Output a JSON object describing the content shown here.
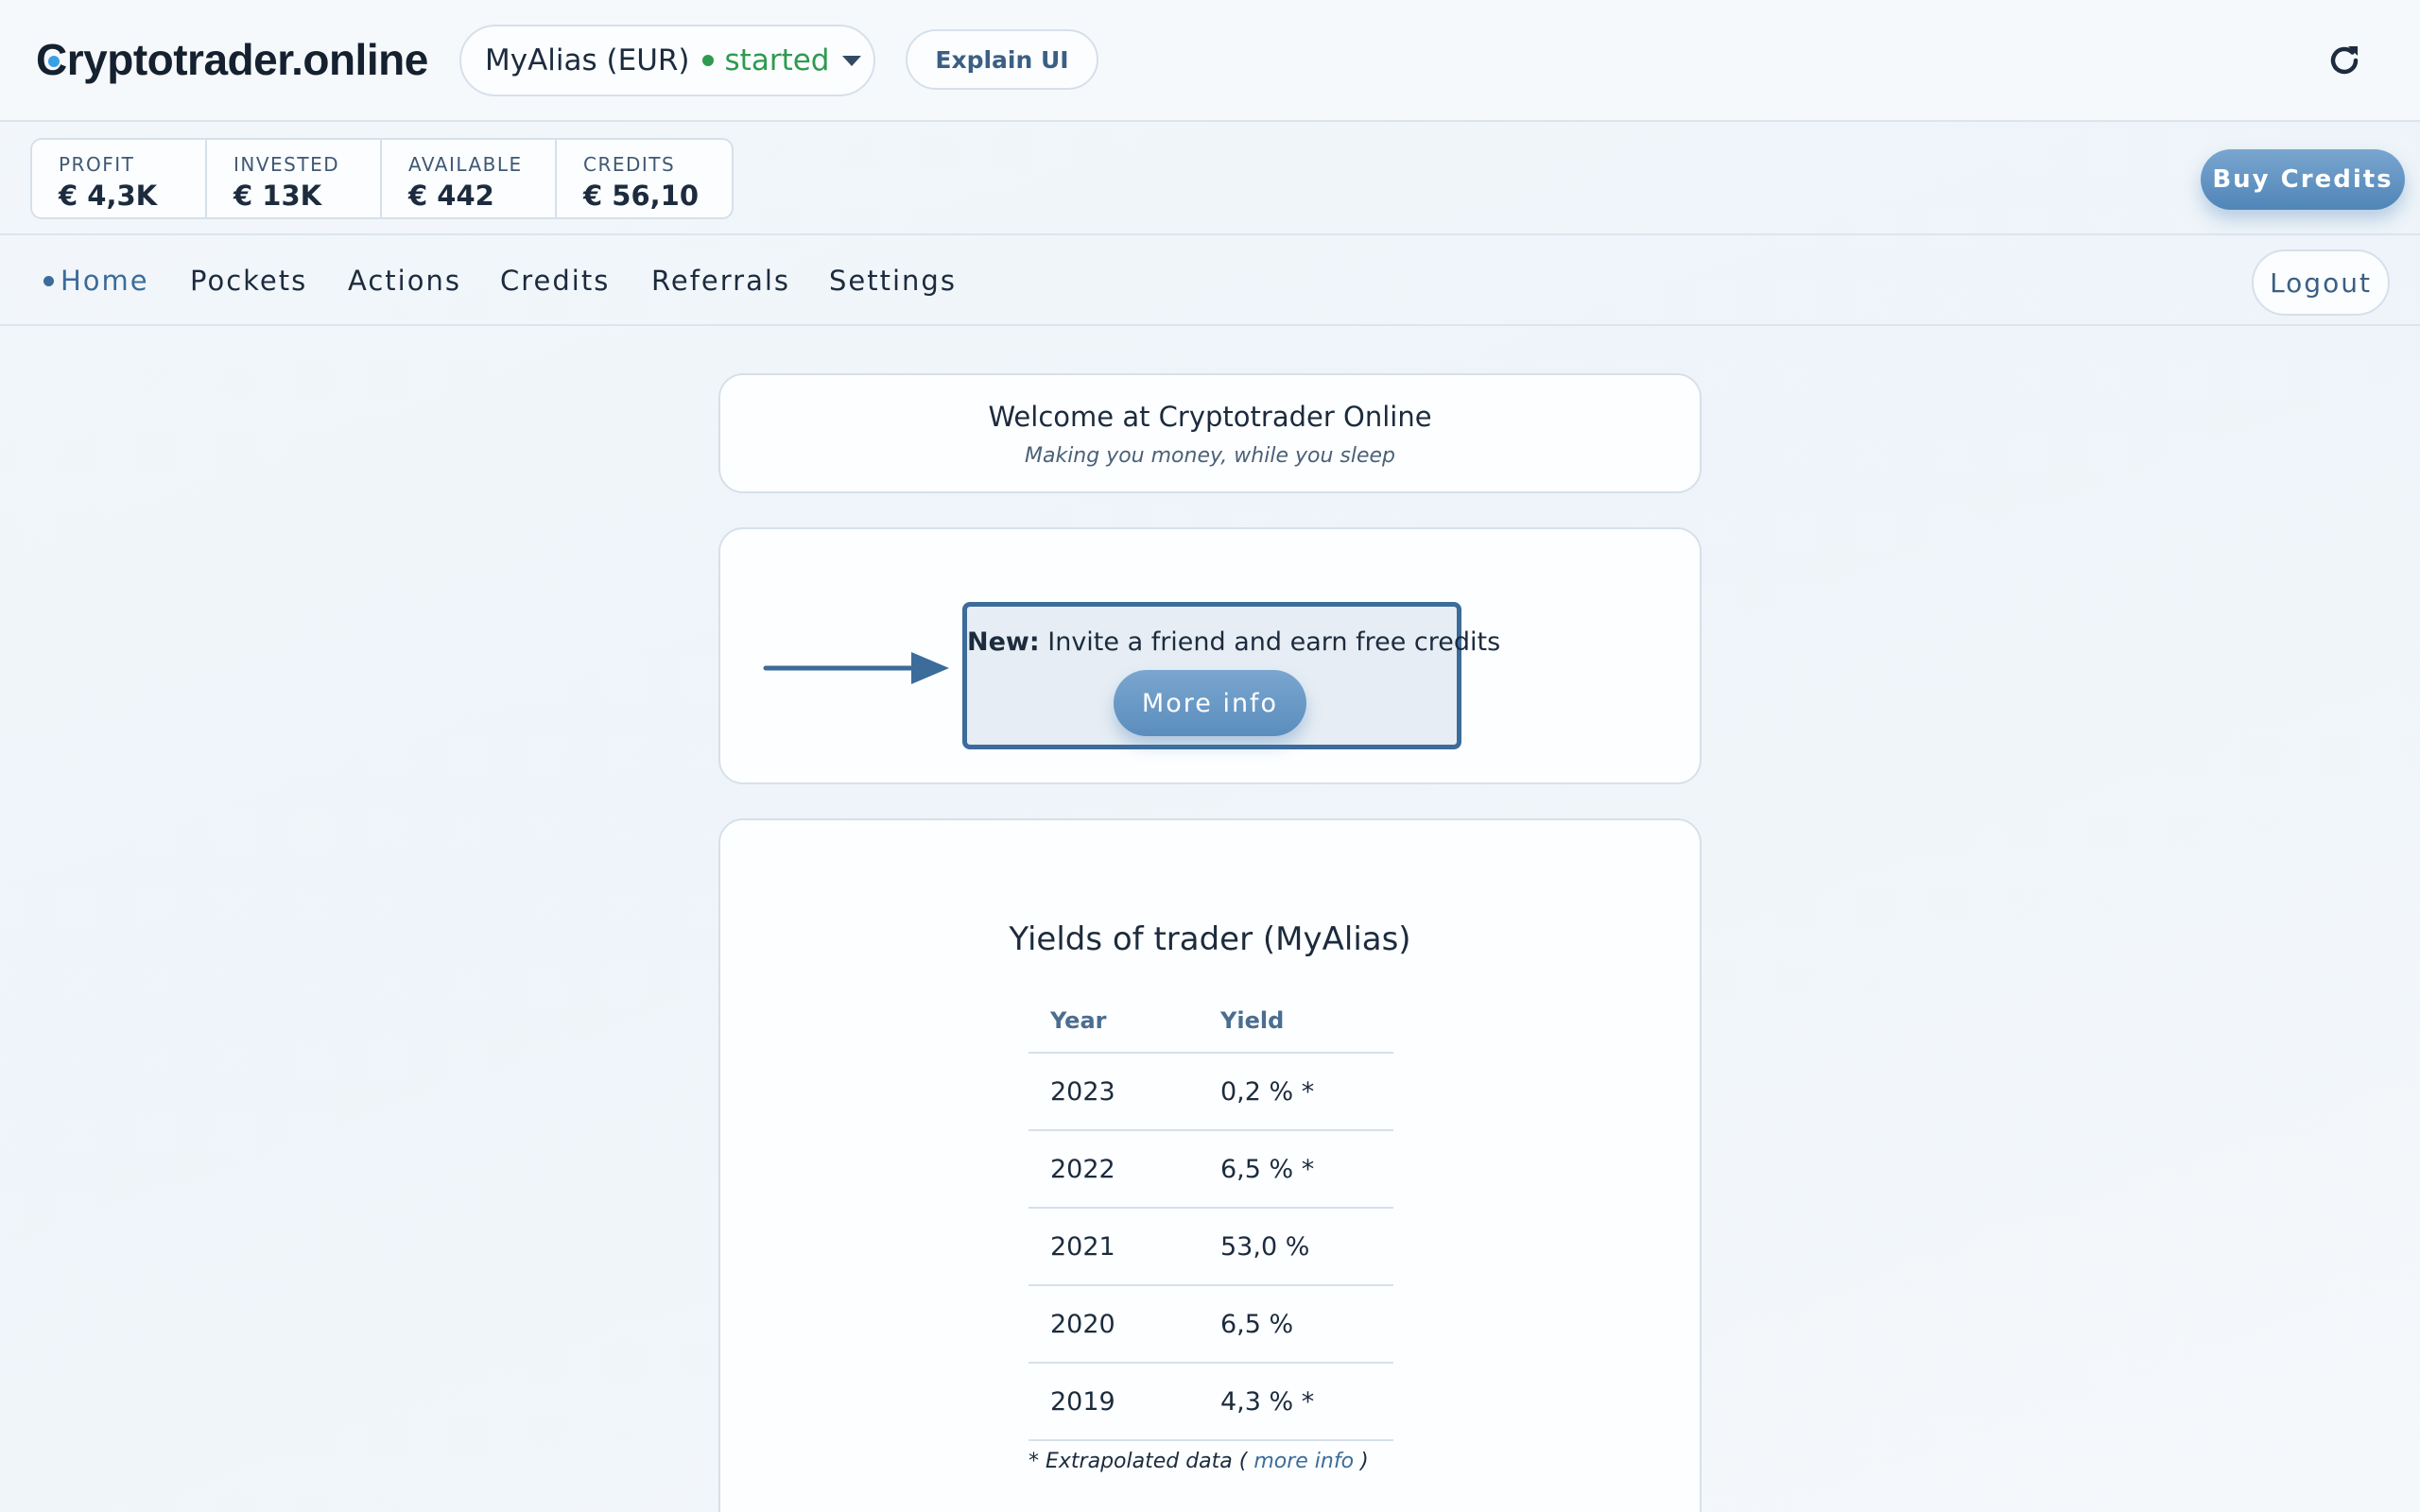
{
  "header": {
    "brand_prefix": "C",
    "brand_rest": "ryptotrader.online",
    "alias_name": "MyAlias (EUR)",
    "alias_status": "started",
    "explain_label": "Explain UI",
    "refresh_icon": "refresh-icon"
  },
  "stats": [
    {
      "label": "PROFIT",
      "value": "€ 4,3K"
    },
    {
      "label": "INVESTED",
      "value": "€ 13K"
    },
    {
      "label": "AVAILABLE",
      "value": "€ 442"
    },
    {
      "label": "CREDITS",
      "value": "€ 56,10"
    }
  ],
  "buy_credits_label": "Buy Credits",
  "nav": {
    "items": [
      "Home",
      "Pockets",
      "Actions",
      "Credits",
      "Referrals",
      "Settings"
    ],
    "active": "Home",
    "logout_label": "Logout"
  },
  "welcome": {
    "title": "Welcome at Cryptotrader Online",
    "subtitle": "Making you money, while you sleep"
  },
  "promo": {
    "new_label": "New:",
    "text": " Invite a friend and earn free credits",
    "button_label": "More info"
  },
  "yields": {
    "title": "Yields of trader (MyAlias)",
    "headers": [
      "Year",
      "Yield"
    ],
    "rows": [
      {
        "year": "2023",
        "yield": "0,2 % *"
      },
      {
        "year": "2022",
        "yield": "6,5 % *"
      },
      {
        "year": "2021",
        "yield": "53,0 %"
      },
      {
        "year": "2020",
        "yield": "6,5 %"
      },
      {
        "year": "2019",
        "yield": "4,3 % *"
      }
    ],
    "footnote_prefix": "* Extrapolated data (",
    "footnote_link": " more info ",
    "footnote_suffix": ")"
  },
  "colors": {
    "accent": "#3b6c9a",
    "status_green": "#2e9b4f",
    "button_blue": "#5b8dbd"
  }
}
